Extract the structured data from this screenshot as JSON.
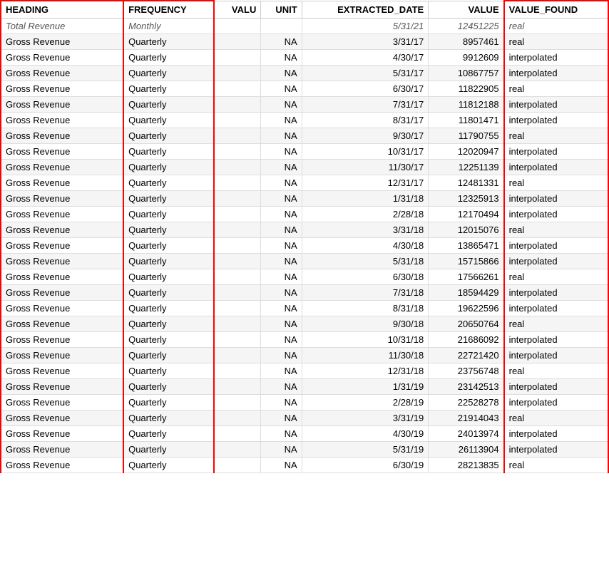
{
  "table": {
    "columns": [
      "HEADING",
      "FREQUENCY",
      "VALU",
      "UNIT",
      "EXTRACTED_DATE",
      "VALUE",
      "VALUE_FOUND"
    ],
    "partial_row": {
      "heading": "Total Revenue",
      "frequency": "Monthly",
      "valu": "",
      "unit": "",
      "extracted_date": "5/31/21",
      "value": "12451225",
      "value_found": "real"
    },
    "rows": [
      {
        "heading": "Gross Revenue",
        "frequency": "Quarterly",
        "valu": "",
        "unit": "NA",
        "extracted_date": "3/31/17",
        "value": "8957461",
        "value_found": "real"
      },
      {
        "heading": "Gross Revenue",
        "frequency": "Quarterly",
        "valu": "",
        "unit": "NA",
        "extracted_date": "4/30/17",
        "value": "9912609",
        "value_found": "interpolated"
      },
      {
        "heading": "Gross Revenue",
        "frequency": "Quarterly",
        "valu": "",
        "unit": "NA",
        "extracted_date": "5/31/17",
        "value": "10867757",
        "value_found": "interpolated"
      },
      {
        "heading": "Gross Revenue",
        "frequency": "Quarterly",
        "valu": "",
        "unit": "NA",
        "extracted_date": "6/30/17",
        "value": "11822905",
        "value_found": "real"
      },
      {
        "heading": "Gross Revenue",
        "frequency": "Quarterly",
        "valu": "",
        "unit": "NA",
        "extracted_date": "7/31/17",
        "value": "11812188",
        "value_found": "interpolated"
      },
      {
        "heading": "Gross Revenue",
        "frequency": "Quarterly",
        "valu": "",
        "unit": "NA",
        "extracted_date": "8/31/17",
        "value": "11801471",
        "value_found": "interpolated"
      },
      {
        "heading": "Gross Revenue",
        "frequency": "Quarterly",
        "valu": "",
        "unit": "NA",
        "extracted_date": "9/30/17",
        "value": "11790755",
        "value_found": "real"
      },
      {
        "heading": "Gross Revenue",
        "frequency": "Quarterly",
        "valu": "",
        "unit": "NA",
        "extracted_date": "10/31/17",
        "value": "12020947",
        "value_found": "interpolated"
      },
      {
        "heading": "Gross Revenue",
        "frequency": "Quarterly",
        "valu": "",
        "unit": "NA",
        "extracted_date": "11/30/17",
        "value": "12251139",
        "value_found": "interpolated"
      },
      {
        "heading": "Gross Revenue",
        "frequency": "Quarterly",
        "valu": "",
        "unit": "NA",
        "extracted_date": "12/31/17",
        "value": "12481331",
        "value_found": "real"
      },
      {
        "heading": "Gross Revenue",
        "frequency": "Quarterly",
        "valu": "",
        "unit": "NA",
        "extracted_date": "1/31/18",
        "value": "12325913",
        "value_found": "interpolated"
      },
      {
        "heading": "Gross Revenue",
        "frequency": "Quarterly",
        "valu": "",
        "unit": "NA",
        "extracted_date": "2/28/18",
        "value": "12170494",
        "value_found": "interpolated"
      },
      {
        "heading": "Gross Revenue",
        "frequency": "Quarterly",
        "valu": "",
        "unit": "NA",
        "extracted_date": "3/31/18",
        "value": "12015076",
        "value_found": "real"
      },
      {
        "heading": "Gross Revenue",
        "frequency": "Quarterly",
        "valu": "",
        "unit": "NA",
        "extracted_date": "4/30/18",
        "value": "13865471",
        "value_found": "interpolated"
      },
      {
        "heading": "Gross Revenue",
        "frequency": "Quarterly",
        "valu": "",
        "unit": "NA",
        "extracted_date": "5/31/18",
        "value": "15715866",
        "value_found": "interpolated"
      },
      {
        "heading": "Gross Revenue",
        "frequency": "Quarterly",
        "valu": "",
        "unit": "NA",
        "extracted_date": "6/30/18",
        "value": "17566261",
        "value_found": "real"
      },
      {
        "heading": "Gross Revenue",
        "frequency": "Quarterly",
        "valu": "",
        "unit": "NA",
        "extracted_date": "7/31/18",
        "value": "18594429",
        "value_found": "interpolated"
      },
      {
        "heading": "Gross Revenue",
        "frequency": "Quarterly",
        "valu": "",
        "unit": "NA",
        "extracted_date": "8/31/18",
        "value": "19622596",
        "value_found": "interpolated"
      },
      {
        "heading": "Gross Revenue",
        "frequency": "Quarterly",
        "valu": "",
        "unit": "NA",
        "extracted_date": "9/30/18",
        "value": "20650764",
        "value_found": "real"
      },
      {
        "heading": "Gross Revenue",
        "frequency": "Quarterly",
        "valu": "",
        "unit": "NA",
        "extracted_date": "10/31/18",
        "value": "21686092",
        "value_found": "interpolated"
      },
      {
        "heading": "Gross Revenue",
        "frequency": "Quarterly",
        "valu": "",
        "unit": "NA",
        "extracted_date": "11/30/18",
        "value": "22721420",
        "value_found": "interpolated"
      },
      {
        "heading": "Gross Revenue",
        "frequency": "Quarterly",
        "valu": "",
        "unit": "NA",
        "extracted_date": "12/31/18",
        "value": "23756748",
        "value_found": "real"
      },
      {
        "heading": "Gross Revenue",
        "frequency": "Quarterly",
        "valu": "",
        "unit": "NA",
        "extracted_date": "1/31/19",
        "value": "23142513",
        "value_found": "interpolated"
      },
      {
        "heading": "Gross Revenue",
        "frequency": "Quarterly",
        "valu": "",
        "unit": "NA",
        "extracted_date": "2/28/19",
        "value": "22528278",
        "value_found": "interpolated"
      },
      {
        "heading": "Gross Revenue",
        "frequency": "Quarterly",
        "valu": "",
        "unit": "NA",
        "extracted_date": "3/31/19",
        "value": "21914043",
        "value_found": "real"
      },
      {
        "heading": "Gross Revenue",
        "frequency": "Quarterly",
        "valu": "",
        "unit": "NA",
        "extracted_date": "4/30/19",
        "value": "24013974",
        "value_found": "interpolated"
      },
      {
        "heading": "Gross Revenue",
        "frequency": "Quarterly",
        "valu": "",
        "unit": "NA",
        "extracted_date": "5/31/19",
        "value": "26113904",
        "value_found": "interpolated"
      },
      {
        "heading": "Gross Revenue",
        "frequency": "Quarterly",
        "valu": "",
        "unit": "NA",
        "extracted_date": "6/30/19",
        "value": "28213835",
        "value_found": "real"
      }
    ]
  }
}
